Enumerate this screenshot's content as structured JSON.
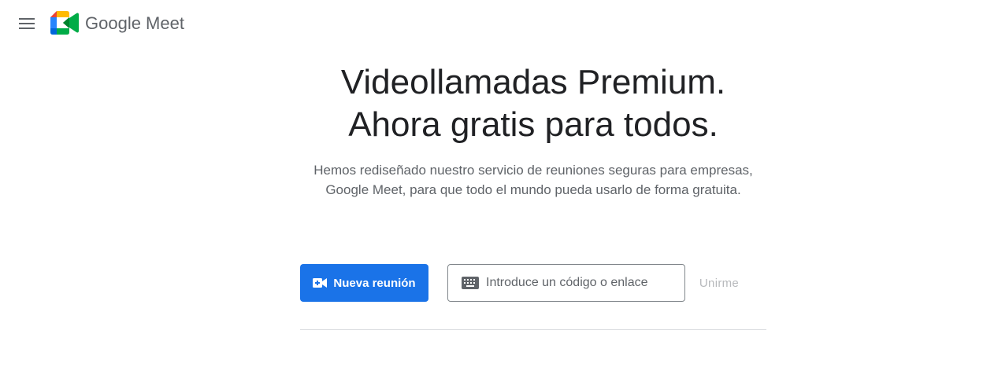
{
  "header": {
    "brand_text": "Google Meet"
  },
  "hero": {
    "headline_line1": "Videollamadas Premium.",
    "headline_line2": "Ahora gratis para todos.",
    "subtext": "Hemos rediseñado nuestro servicio de reuniones seguras para empresas, Google Meet, para que todo el mundo pueda usarlo de forma gratuita."
  },
  "actions": {
    "new_meeting_label": "Nueva reunión",
    "code_placeholder": "Introduce un código o enlace",
    "join_label": "Unirme"
  },
  "colors": {
    "primary_button": "#1a73e8",
    "join_disabled": "#b7b9bc",
    "headline": "#202124",
    "subtext": "#5f6368"
  },
  "icons": {
    "menu": "hamburger-menu-icon",
    "logo": "google-meet-logo",
    "new_meeting": "video-camera-plus-icon",
    "keyboard": "keyboard-icon"
  }
}
